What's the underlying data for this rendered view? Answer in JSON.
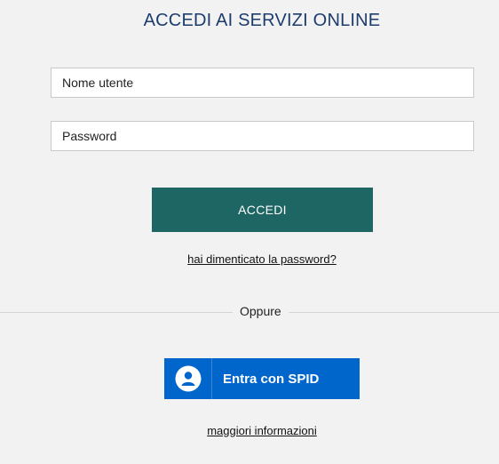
{
  "header": {
    "title": "ACCEDI AI SERVIZI ONLINE"
  },
  "form": {
    "username_placeholder": "Nome utente",
    "password_placeholder": "Password",
    "submit_label": "ACCEDI",
    "forgot_link": "hai dimenticato la password?"
  },
  "divider": {
    "label": "Oppure"
  },
  "spid": {
    "button_label": "Entra con SPID",
    "more_info_link": "maggiori informazioni",
    "icon": "user-icon"
  },
  "colors": {
    "background": "#f2f2f2",
    "title": "#1d3c6e",
    "accent": "#1e6663",
    "spid_blue": "#0066cc"
  }
}
